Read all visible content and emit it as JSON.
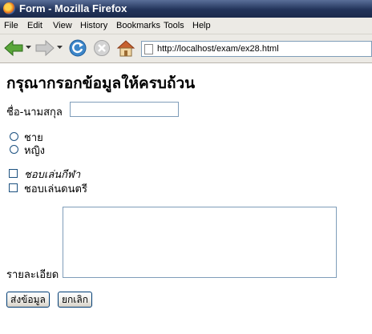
{
  "window": {
    "title": "Form - Mozilla Firefox"
  },
  "menu": {
    "items": [
      "File",
      "Edit",
      "View",
      "History",
      "Bookmarks",
      "Tools",
      "Help"
    ]
  },
  "toolbar": {
    "url": "http://localhost/exam/ex28.html"
  },
  "form": {
    "heading": "กรุณากรอกข้อมูลให้ครบถ้วน",
    "name_label": "ชื่อ-นามสกุล",
    "name_value": "",
    "gender": [
      {
        "label": "ชาย",
        "checked": false
      },
      {
        "label": "หญิง",
        "checked": false
      }
    ],
    "hobbies": [
      {
        "label": "ชอบเล่นกีฬา",
        "checked": false
      },
      {
        "label": "ชอบเล่นดนตรี",
        "checked": false
      }
    ],
    "detail_label": "รายละเอียด",
    "detail_value": "",
    "submit_label": "ส่งข้อมูล",
    "reset_label": "ยกเลิก"
  },
  "colors": {
    "titlebar": "#22335a",
    "chrome": "#eceae5",
    "field_border": "#7f9db9"
  }
}
